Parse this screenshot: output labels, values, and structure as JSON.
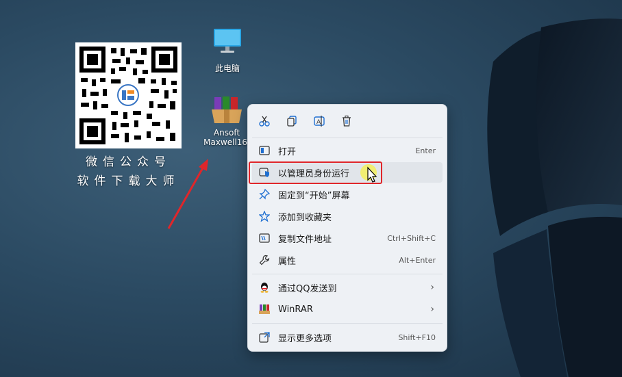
{
  "desktop": {
    "this_pc_label": "此电脑",
    "app_label_line1": "Ansoft",
    "app_label_line2": "Maxwell16.",
    "caption_line1": "微信公众号",
    "caption_line2": "软件下载大师"
  },
  "menu": {
    "items": [
      {
        "label": "打开",
        "shortcut": "Enter",
        "icon": "open-window-icon"
      },
      {
        "label": "以管理员身份运行",
        "shortcut": "",
        "icon": "shield-icon"
      },
      {
        "label": "固定到“开始”屏幕",
        "shortcut": "",
        "icon": "pin-icon"
      },
      {
        "label": "添加到收藏夹",
        "shortcut": "",
        "icon": "star-icon"
      },
      {
        "label": "复制文件地址",
        "shortcut": "Ctrl+Shift+C",
        "icon": "copy-path-icon"
      },
      {
        "label": "属性",
        "shortcut": "Alt+Enter",
        "icon": "wrench-icon"
      },
      {
        "label": "通过QQ发送到",
        "shortcut": "",
        "icon": "qq-icon"
      },
      {
        "label": "WinRAR",
        "shortcut": "",
        "icon": "winrar-icon"
      },
      {
        "label": "显示更多选项",
        "shortcut": "Shift+F10",
        "icon": "more-options-icon"
      }
    ]
  },
  "colors": {
    "accent": "#1f6fd1",
    "highlight_border": "#e0262a",
    "arrow": "#e0262a"
  }
}
